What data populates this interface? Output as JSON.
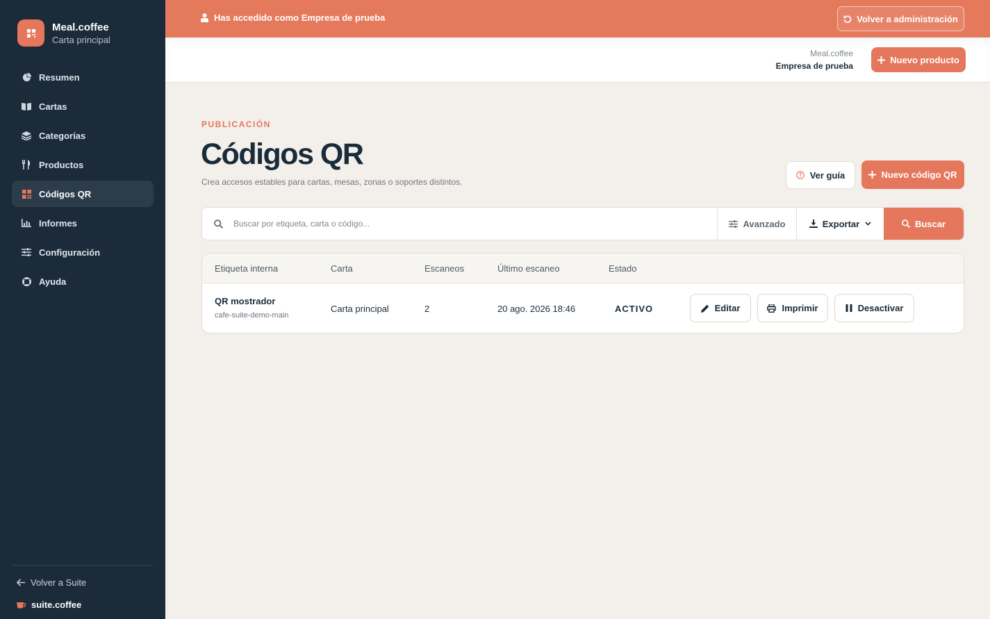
{
  "app": {
    "name": "Meal.coffee",
    "subtitle": "Carta principal"
  },
  "sidebar": {
    "items": [
      {
        "label": "Resumen",
        "icon": "pie-chart-icon"
      },
      {
        "label": "Cartas",
        "icon": "book-icon"
      },
      {
        "label": "Categorías",
        "icon": "layers-icon"
      },
      {
        "label": "Productos",
        "icon": "utensils-icon"
      },
      {
        "label": "Códigos QR",
        "icon": "qr-grid-icon",
        "active": true
      },
      {
        "label": "Informes",
        "icon": "bar-chart-icon"
      },
      {
        "label": "Configuración",
        "icon": "sliders-icon"
      },
      {
        "label": "Ayuda",
        "icon": "lifebuoy-icon"
      }
    ],
    "back_label": "Volver a Suite",
    "suite_brand": "suite.coffee"
  },
  "banner": {
    "text": "Has accedido como Empresa de prueba",
    "button": "Volver a administración",
    "color": "#e5795c"
  },
  "topbar": {
    "app_name": "Meal.coffee",
    "company": "Empresa de prueba",
    "new_product": "Nuevo producto"
  },
  "page": {
    "eyebrow": "PUBLICACIÓN",
    "title": "Códigos QR",
    "description": "Crea accesos estables para cartas, mesas, zonas o soportes distintos.",
    "guide_button": "Ver guía",
    "new_qr_button": "Nuevo código QR"
  },
  "search": {
    "placeholder": "Buscar por etiqueta, carta o código...",
    "value": "",
    "advanced": "Avanzado",
    "export": "Exportar",
    "submit": "Buscar"
  },
  "table": {
    "headers": [
      "Etiqueta interna",
      "Carta",
      "Escaneos",
      "Último escaneo",
      "Estado"
    ],
    "rows": [
      {
        "label": "QR mostrador",
        "code": "cafe-suite-demo-main",
        "carta": "Carta principal",
        "scans": "2",
        "last_scan": "20 ago. 2026 18:46",
        "status": "ACTIVO",
        "actions": {
          "edit": "Editar",
          "print": "Imprimir",
          "deactivate": "Desactivar"
        }
      }
    ]
  },
  "colors": {
    "accent": "#e5775c",
    "sidebar": "#1b2b3a",
    "background": "#f3f0eb"
  }
}
